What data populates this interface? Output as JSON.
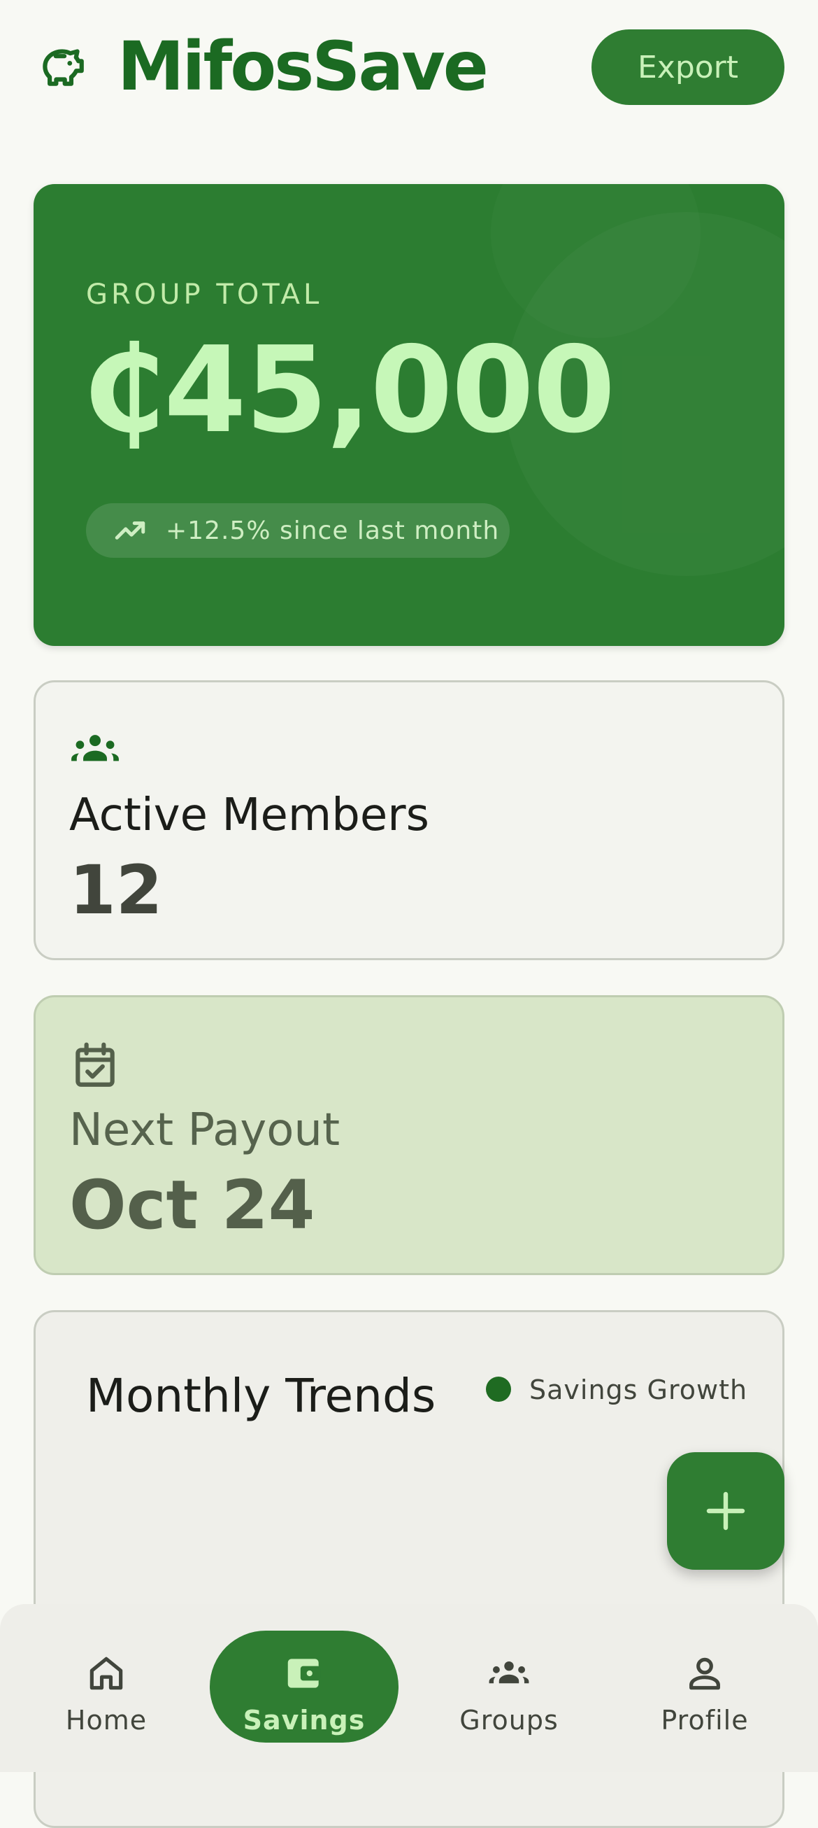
{
  "header": {
    "app_name": "MifosSave",
    "export_label": "Export",
    "logo_icon": "piggy-bank-icon"
  },
  "hero": {
    "label": "GROUP TOTAL",
    "amount": "₵45,000",
    "trend_text": "+12.5% since last month",
    "trend_icon": "trending-up-icon"
  },
  "members_card": {
    "icon": "groups-icon",
    "label": "Active Members",
    "value": "12"
  },
  "payout_card": {
    "icon": "event-available-icon",
    "label": "Next Payout",
    "value": "Oct 24"
  },
  "trends_card": {
    "title": "Monthly Trends",
    "legend_label": "Savings Growth"
  },
  "fab": {
    "icon": "plus-icon"
  },
  "bottom_nav": {
    "items": [
      {
        "label": "Home",
        "icon": "home-icon",
        "active": false
      },
      {
        "label": "Savings",
        "icon": "wallet-icon",
        "active": true
      },
      {
        "label": "Groups",
        "icon": "groups-icon",
        "active": false
      },
      {
        "label": "Profile",
        "icon": "person-icon",
        "active": false
      }
    ]
  },
  "colors": {
    "primary": "#2f7d32",
    "brand_text": "#1b6a22",
    "on_primary_container": "#c6f7b8",
    "background": "#f8f9f4",
    "secondary_container": "#d8e6c8"
  }
}
